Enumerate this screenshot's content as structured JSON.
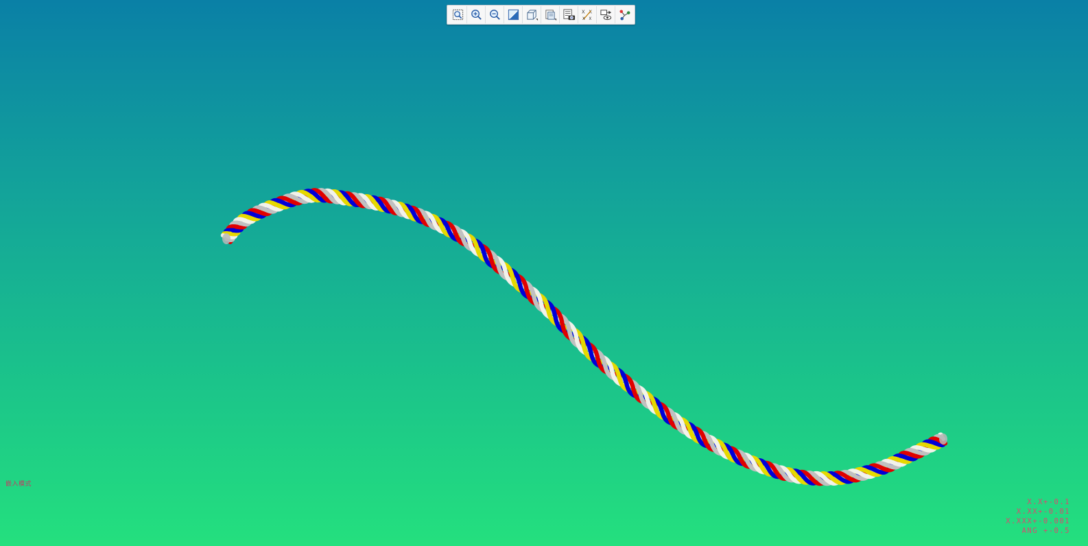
{
  "toolbar": {
    "buttons": [
      {
        "name": "refit-icon"
      },
      {
        "name": "zoom-in-icon"
      },
      {
        "name": "zoom-out-icon"
      },
      {
        "name": "repaint-icon"
      },
      {
        "name": "display-style-icon"
      },
      {
        "name": "saved-views-icon"
      },
      {
        "name": "view-manager-icon"
      },
      {
        "name": "annotation-display-icon"
      },
      {
        "name": "view-visibility-icon"
      },
      {
        "name": "spin-center-icon"
      }
    ]
  },
  "model": {
    "strand_colors": [
      "#c0c0c0",
      "#e00000",
      "#0000d8",
      "#e6d800",
      "#f2f2ea"
    ]
  },
  "status": {
    "mode_label": "嵌入模式"
  },
  "tolerances": [
    "X.X+-0.1",
    "X.XX+-0.01",
    "X.XXX+-0.001",
    "ANG +-0.5"
  ]
}
